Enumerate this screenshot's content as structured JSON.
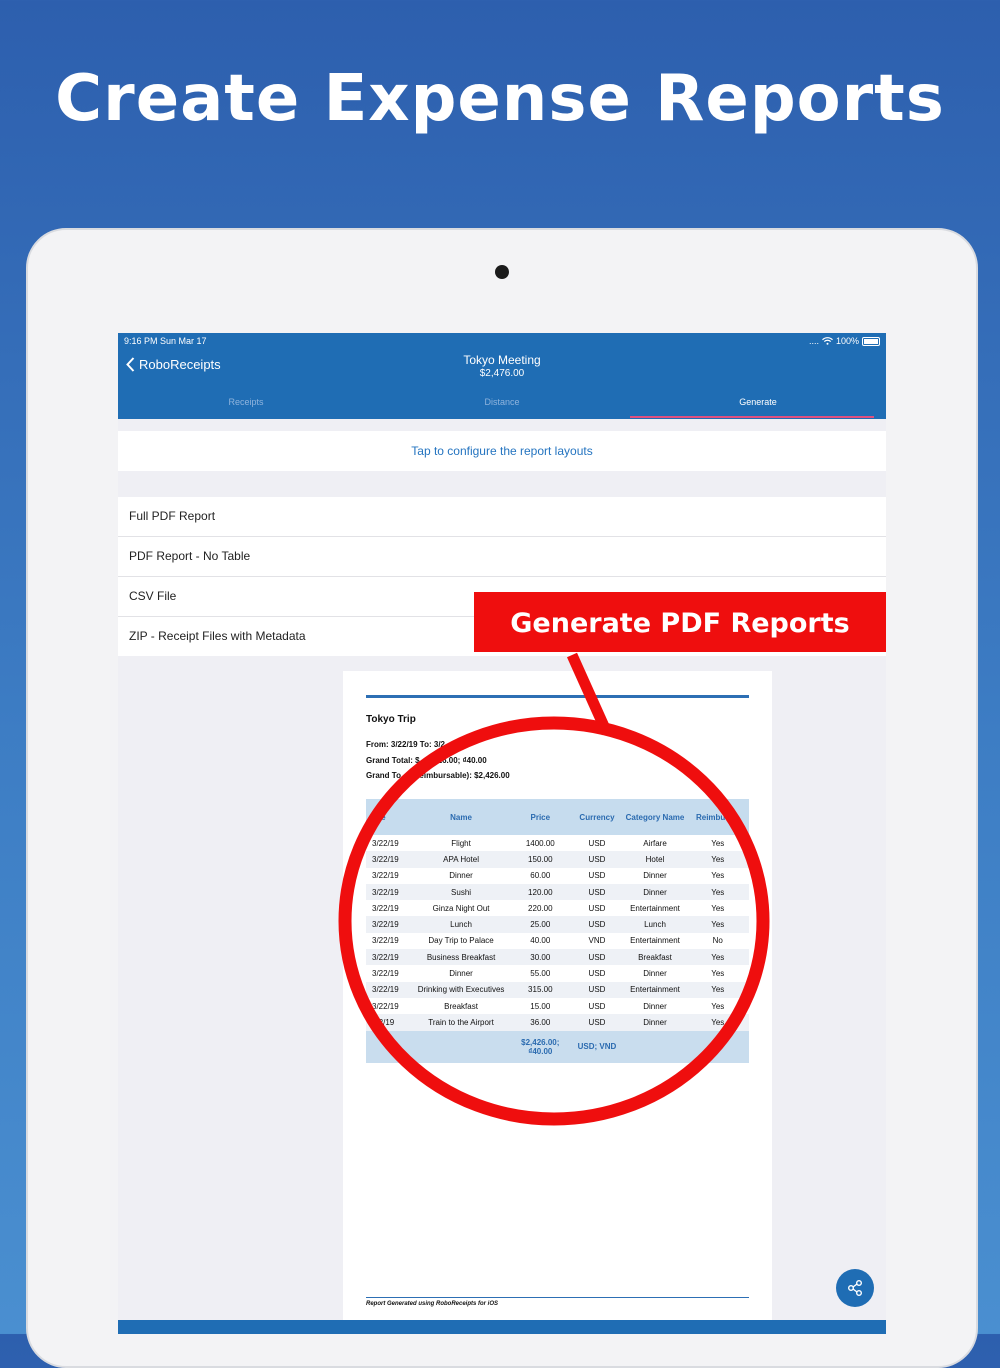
{
  "headline": "Create Expense Reports",
  "status": {
    "time": "9:16 PM   Sun Mar 17",
    "battery": "100%"
  },
  "nav": {
    "back_label": "RoboReceipts",
    "title": "Tokyo Meeting",
    "subtitle": "$2,476.00"
  },
  "tabs": [
    {
      "label": "Receipts"
    },
    {
      "label": "Distance"
    },
    {
      "label": "Generate"
    }
  ],
  "config_link": "Tap to configure the report layouts",
  "options": [
    {
      "label": "Full PDF Report"
    },
    {
      "label": "PDF Report - No Table"
    },
    {
      "label": "CSV File"
    },
    {
      "label": "ZIP - Receipt Files with Metadata"
    }
  ],
  "banner": "Generate PDF Reports",
  "report": {
    "title": "Tokyo Trip",
    "from": "From: 3/22/19 To: 3/2",
    "grand_total": "Grand Total: $",
    "grand_total_tail": "26.00; ₫40.00",
    "grand_reimb_head": "Grand To",
    "grand_reimb": "(Reimbursable): $2,426.00",
    "columns": [
      "ate",
      "Name",
      "Price",
      "Currency",
      "Category Name",
      "Reimburs  e"
    ],
    "rows": [
      {
        "date": "3/22/19",
        "name": "Flight",
        "price": "1400.00",
        "currency": "USD",
        "category": "Airfare",
        "reimb": "Yes"
      },
      {
        "date": "3/22/19",
        "name": "APA Hotel",
        "price": "150.00",
        "currency": "USD",
        "category": "Hotel",
        "reimb": "Yes"
      },
      {
        "date": "3/22/19",
        "name": "Dinner",
        "price": "60.00",
        "currency": "USD",
        "category": "Dinner",
        "reimb": "Yes"
      },
      {
        "date": "3/22/19",
        "name": "Sushi",
        "price": "120.00",
        "currency": "USD",
        "category": "Dinner",
        "reimb": "Yes"
      },
      {
        "date": "3/22/19",
        "name": "Ginza Night Out",
        "price": "220.00",
        "currency": "USD",
        "category": "Entertainment",
        "reimb": "Yes"
      },
      {
        "date": "3/22/19",
        "name": "Lunch",
        "price": "25.00",
        "currency": "USD",
        "category": "Lunch",
        "reimb": "Yes"
      },
      {
        "date": "3/22/19",
        "name": "Day Trip to Palace",
        "price": "40.00",
        "currency": "VND",
        "category": "Entertainment",
        "reimb": "No"
      },
      {
        "date": "3/22/19",
        "name": "Business Breakfast",
        "price": "30.00",
        "currency": "USD",
        "category": "Breakfast",
        "reimb": "Yes"
      },
      {
        "date": "3/22/19",
        "name": "Dinner",
        "price": "55.00",
        "currency": "USD",
        "category": "Dinner",
        "reimb": "Yes"
      },
      {
        "date": "3/22/19",
        "name": "Drinking with Executives",
        "price": "315.00",
        "currency": "USD",
        "category": "Entertainment",
        "reimb": "Yes"
      },
      {
        "date": "3/22/19",
        "name": "Breakfast",
        "price": "15.00",
        "currency": "USD",
        "category": "Dinner",
        "reimb": "Yes"
      },
      {
        "date": "/22/19",
        "name": "Train to the Airport",
        "price": "36.00",
        "currency": "USD",
        "category": "Dinner",
        "reimb": "Yes"
      }
    ],
    "total_price": "$2,426.00; ₫40.00",
    "total_currency": "USD; VND",
    "footer": "Report Generated using RoboReceipts for iOS"
  },
  "colors": {
    "nav": "#1f6db4",
    "accent": "#e0507f",
    "banner": "#ef0e0e",
    "link": "#2474c0"
  },
  "icons": {
    "back": "chevron-left-icon",
    "share": "share-icon",
    "wifi": "wifi-icon",
    "battery": "battery-icon"
  }
}
